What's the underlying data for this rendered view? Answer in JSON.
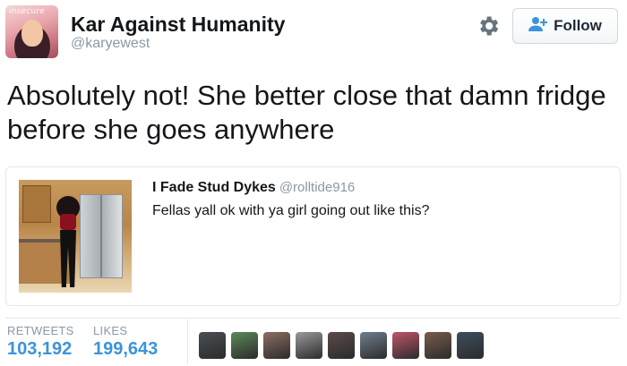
{
  "user": {
    "display_name": "Kar Against Humanity",
    "handle": "@karyewest",
    "avatar_text": "insecure"
  },
  "follow_button": {
    "label": "Follow"
  },
  "tweet": {
    "text": "Absolutely not! She better close that damn fridge before she goes anywhere"
  },
  "quoted_tweet": {
    "name": "I Fade Stud Dykes",
    "handle": "@rolltide916",
    "text": "Fellas yall ok with ya girl going out like this?"
  },
  "stats": {
    "retweets_label": "RETWEETS",
    "retweets_value": "103,192",
    "likes_label": "LIKES",
    "likes_value": "199,643"
  },
  "colors": {
    "accent": "#3b94d9",
    "muted": "#8899a6",
    "border": "#e1e8ed",
    "liker_avatars": [
      "#4a4f55",
      "#5d8a5a",
      "#8d6e63",
      "#9a9a9a",
      "#5b4a4a",
      "#6f7f8f",
      "#c0566b",
      "#7a5c4c",
      "#3e4e5e"
    ]
  },
  "icons": {
    "settings": "gear-icon",
    "follow": "add-user-icon"
  }
}
